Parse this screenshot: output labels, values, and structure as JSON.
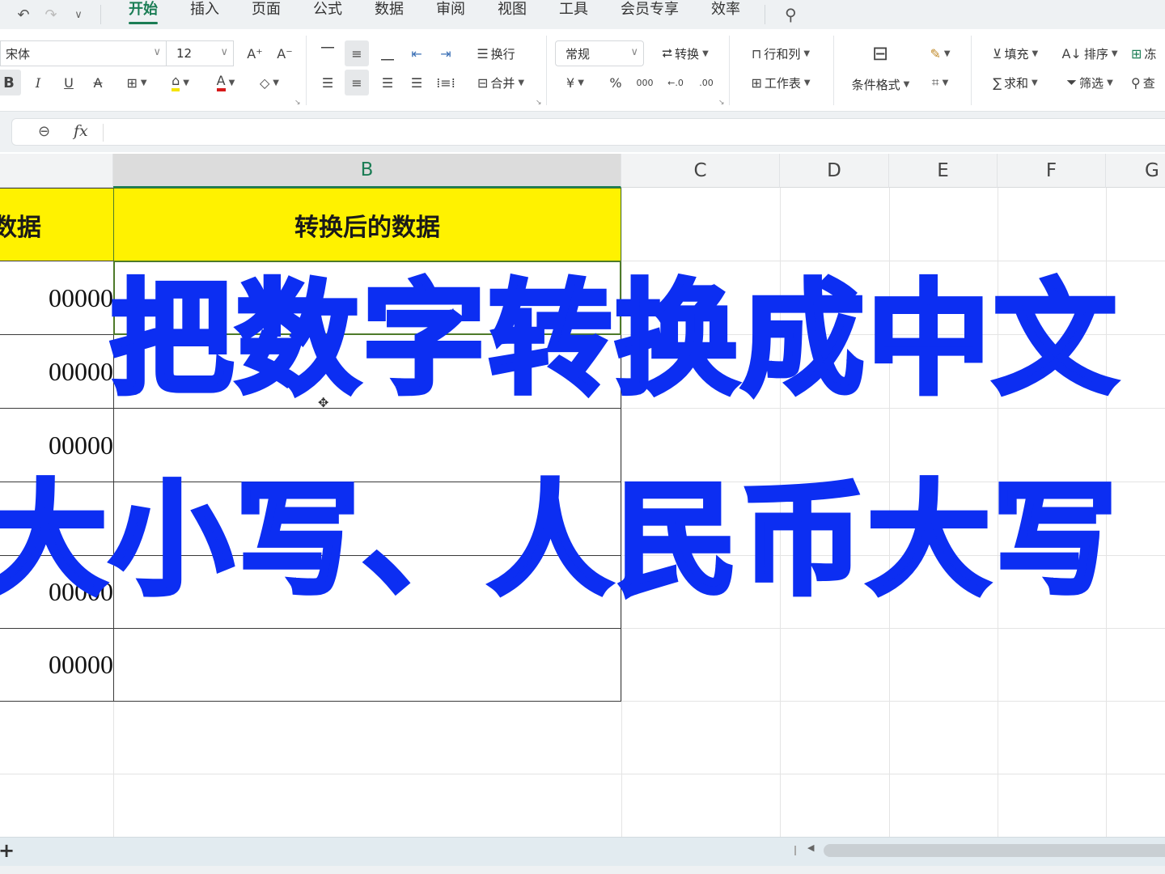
{
  "quick_access": {
    "undo": "↶",
    "redo": "↷",
    "more": "⌄"
  },
  "menu_tabs": [
    {
      "label": "开始",
      "active": true
    },
    {
      "label": "插入",
      "active": false
    },
    {
      "label": "页面",
      "active": false
    },
    {
      "label": "公式",
      "active": false
    },
    {
      "label": "数据",
      "active": false
    },
    {
      "label": "审阅",
      "active": false
    },
    {
      "label": "视图",
      "active": false
    },
    {
      "label": "工具",
      "active": false
    },
    {
      "label": "会员专享",
      "active": false
    },
    {
      "label": "效率",
      "active": false
    }
  ],
  "ribbon": {
    "font_name": "宋体",
    "font_size": "12",
    "increase_font": "A⁺",
    "decrease_font": "A⁻",
    "bold": "B",
    "italic": "I",
    "underline": "U",
    "strikethrough": "A",
    "wrap_label": "换行",
    "merge_label": "合并",
    "number_format": "常规",
    "convert_label": "转换",
    "currency": "¥",
    "percent": "%",
    "thousands": "000",
    "inc_decimal": "←.0",
    "dec_decimal": ".00",
    "rows_cols_label": "行和列",
    "worksheet_label": "工作表",
    "cond_format_label": "条件格式",
    "fill_label": "填充",
    "sort_label": "排序",
    "sum_label": "求和",
    "filter_label": "筛选",
    "find_label": "查",
    "freeze_label": "冻"
  },
  "formula_bar": {
    "fx_label": "fx",
    "value": ""
  },
  "columns": [
    {
      "label": "B",
      "selected": true
    },
    {
      "label": "C",
      "selected": false
    },
    {
      "label": "D",
      "selected": false
    },
    {
      "label": "E",
      "selected": false
    },
    {
      "label": "F",
      "selected": false
    },
    {
      "label": "G",
      "selected": false
    }
  ],
  "table": {
    "header_a": "数据",
    "header_b": "转换后的数据",
    "rows": [
      {
        "a": "00000",
        "b": ""
      },
      {
        "a": "00000",
        "b": ""
      },
      {
        "a": "00000",
        "b": ""
      },
      {
        "a": "",
        "b": ""
      },
      {
        "a": "00000",
        "b": ""
      },
      {
        "a": "00000",
        "b": ""
      }
    ]
  },
  "overlay": {
    "line1": "把数字转换成中文",
    "line2": "大小写、人民币大写"
  },
  "colors": {
    "header_fill": "#fff200",
    "overlay_text": "#0c2ef2",
    "accent": "#1b7d55",
    "selection_border": "#4e7a2a"
  },
  "sheet_bar": {
    "add_sheet": "+"
  }
}
